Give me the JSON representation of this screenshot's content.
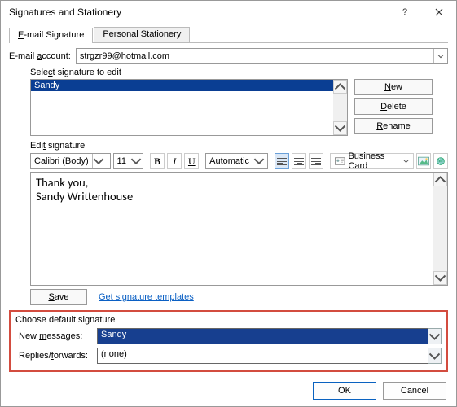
{
  "window": {
    "title": "Signatures and Stationery"
  },
  "tabs": {
    "email_signature": "E-mail Signature",
    "personal_stationery": "Personal Stationery"
  },
  "email_account": {
    "label": "E-mail account:",
    "value": "strgzr99@hotmail.com"
  },
  "select_list": {
    "label": "Select signature to edit",
    "item": "Sandy"
  },
  "side_buttons": {
    "new": "New",
    "delete": "Delete",
    "rename": "Rename"
  },
  "edit": {
    "label": "Edit signature"
  },
  "toolbar": {
    "font": "Calibri (Body)",
    "size": "11",
    "bold": "B",
    "italic": "I",
    "underline": "U",
    "color": "Automatic",
    "business_card": "Business Card"
  },
  "signature_text": "Thank you,\nSandy Writtenhouse",
  "save": {
    "button": "Save",
    "link": "Get signature templates"
  },
  "choose": {
    "header": "Choose default signature",
    "new_messages_label": "New messages:",
    "new_messages_value": "Sandy",
    "replies_label": "Replies/forwards:",
    "replies_value": "(none)"
  },
  "footer": {
    "ok": "OK",
    "cancel": "Cancel"
  }
}
